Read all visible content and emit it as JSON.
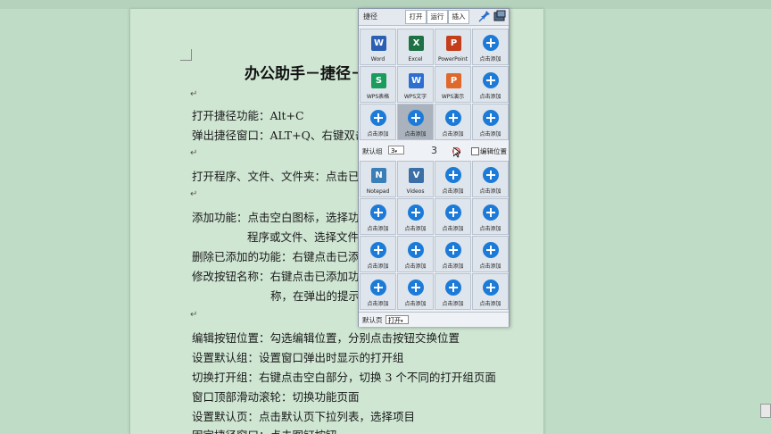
{
  "document": {
    "title": "办公助手－捷径－打开功能",
    "lines": [
      "打开捷径功能：Alt+C",
      "弹出捷径窗口：ALT+Q、右键双击",
      "打开程序、文件、文件夹：点击已设置的按钮",
      "添加功能：点击空白图标，选择功能项目，或者拖入",
      "程序或文件、选择文件夹",
      "删除已添加的功能：右键点击已添加功能的按钮，点击删除",
      "修改按钮名称：右键点击已添加功能的按钮，点击修改名",
      "称，在弹出的提示框中修改名称",
      "编辑按钮位置：勾选编辑位置，分别点击按钮交换位置",
      "设置默认组：设置窗口弹出时显示的打开组",
      "切换打开组：右键点击空白部分，切换 3 个不同的打开组页面",
      "窗口顶部滑动滚轮：切换功能页面",
      "设置默认页：点击默认页下拉列表，选择项目",
      "固定捷径窗口：点击图钉按钮"
    ]
  },
  "panel": {
    "title": "捷径",
    "tabs": [
      "打开",
      "运行",
      "插入"
    ],
    "pin_icon": "pin-icon",
    "screenshot_icon": "screenshot-icon",
    "group1": [
      {
        "label": "Word",
        "type": "app",
        "icon": "W",
        "color": "#2b5fb4"
      },
      {
        "label": "Excel",
        "type": "app",
        "icon": "X",
        "color": "#1e7145"
      },
      {
        "label": "PowerPoint",
        "type": "app",
        "icon": "P",
        "color": "#c43e1c"
      },
      {
        "label": "点击添加",
        "type": "add"
      },
      {
        "label": "WPS表格",
        "type": "app",
        "icon": "S",
        "color": "#1a9c5c"
      },
      {
        "label": "WPS文字",
        "type": "app",
        "icon": "W",
        "color": "#2c6fd1"
      },
      {
        "label": "WPS演示",
        "type": "app",
        "icon": "P",
        "color": "#e0682b"
      },
      {
        "label": "点击添加",
        "type": "add"
      },
      {
        "label": "点击添加",
        "type": "add"
      },
      {
        "label": "点击添加",
        "type": "add",
        "selected": true
      },
      {
        "label": "点击添加",
        "type": "add"
      },
      {
        "label": "点击添加",
        "type": "add"
      }
    ],
    "mid": {
      "default_group_label": "默认组",
      "default_group_value": "3",
      "page_number": "3",
      "edit_position_label": "编辑位置"
    },
    "group2": [
      {
        "label": "Notepad",
        "type": "app",
        "icon": "N",
        "color": "#3b7fb8"
      },
      {
        "label": "Videos",
        "type": "app",
        "icon": "V",
        "color": "#3a6fa8"
      },
      {
        "label": "点击添加",
        "type": "add"
      },
      {
        "label": "点击添加",
        "type": "add"
      },
      {
        "label": "点击添加",
        "type": "add"
      },
      {
        "label": "点击添加",
        "type": "add"
      },
      {
        "label": "点击添加",
        "type": "add"
      },
      {
        "label": "点击添加",
        "type": "add"
      },
      {
        "label": "点击添加",
        "type": "add"
      },
      {
        "label": "点击添加",
        "type": "add"
      },
      {
        "label": "点击添加",
        "type": "add"
      },
      {
        "label": "点击添加",
        "type": "add"
      },
      {
        "label": "点击添加",
        "type": "add"
      },
      {
        "label": "点击添加",
        "type": "add"
      },
      {
        "label": "点击添加",
        "type": "add"
      },
      {
        "label": "点击添加",
        "type": "add"
      }
    ],
    "footer": {
      "default_page_label": "默认页",
      "default_page_value": "打开"
    }
  }
}
